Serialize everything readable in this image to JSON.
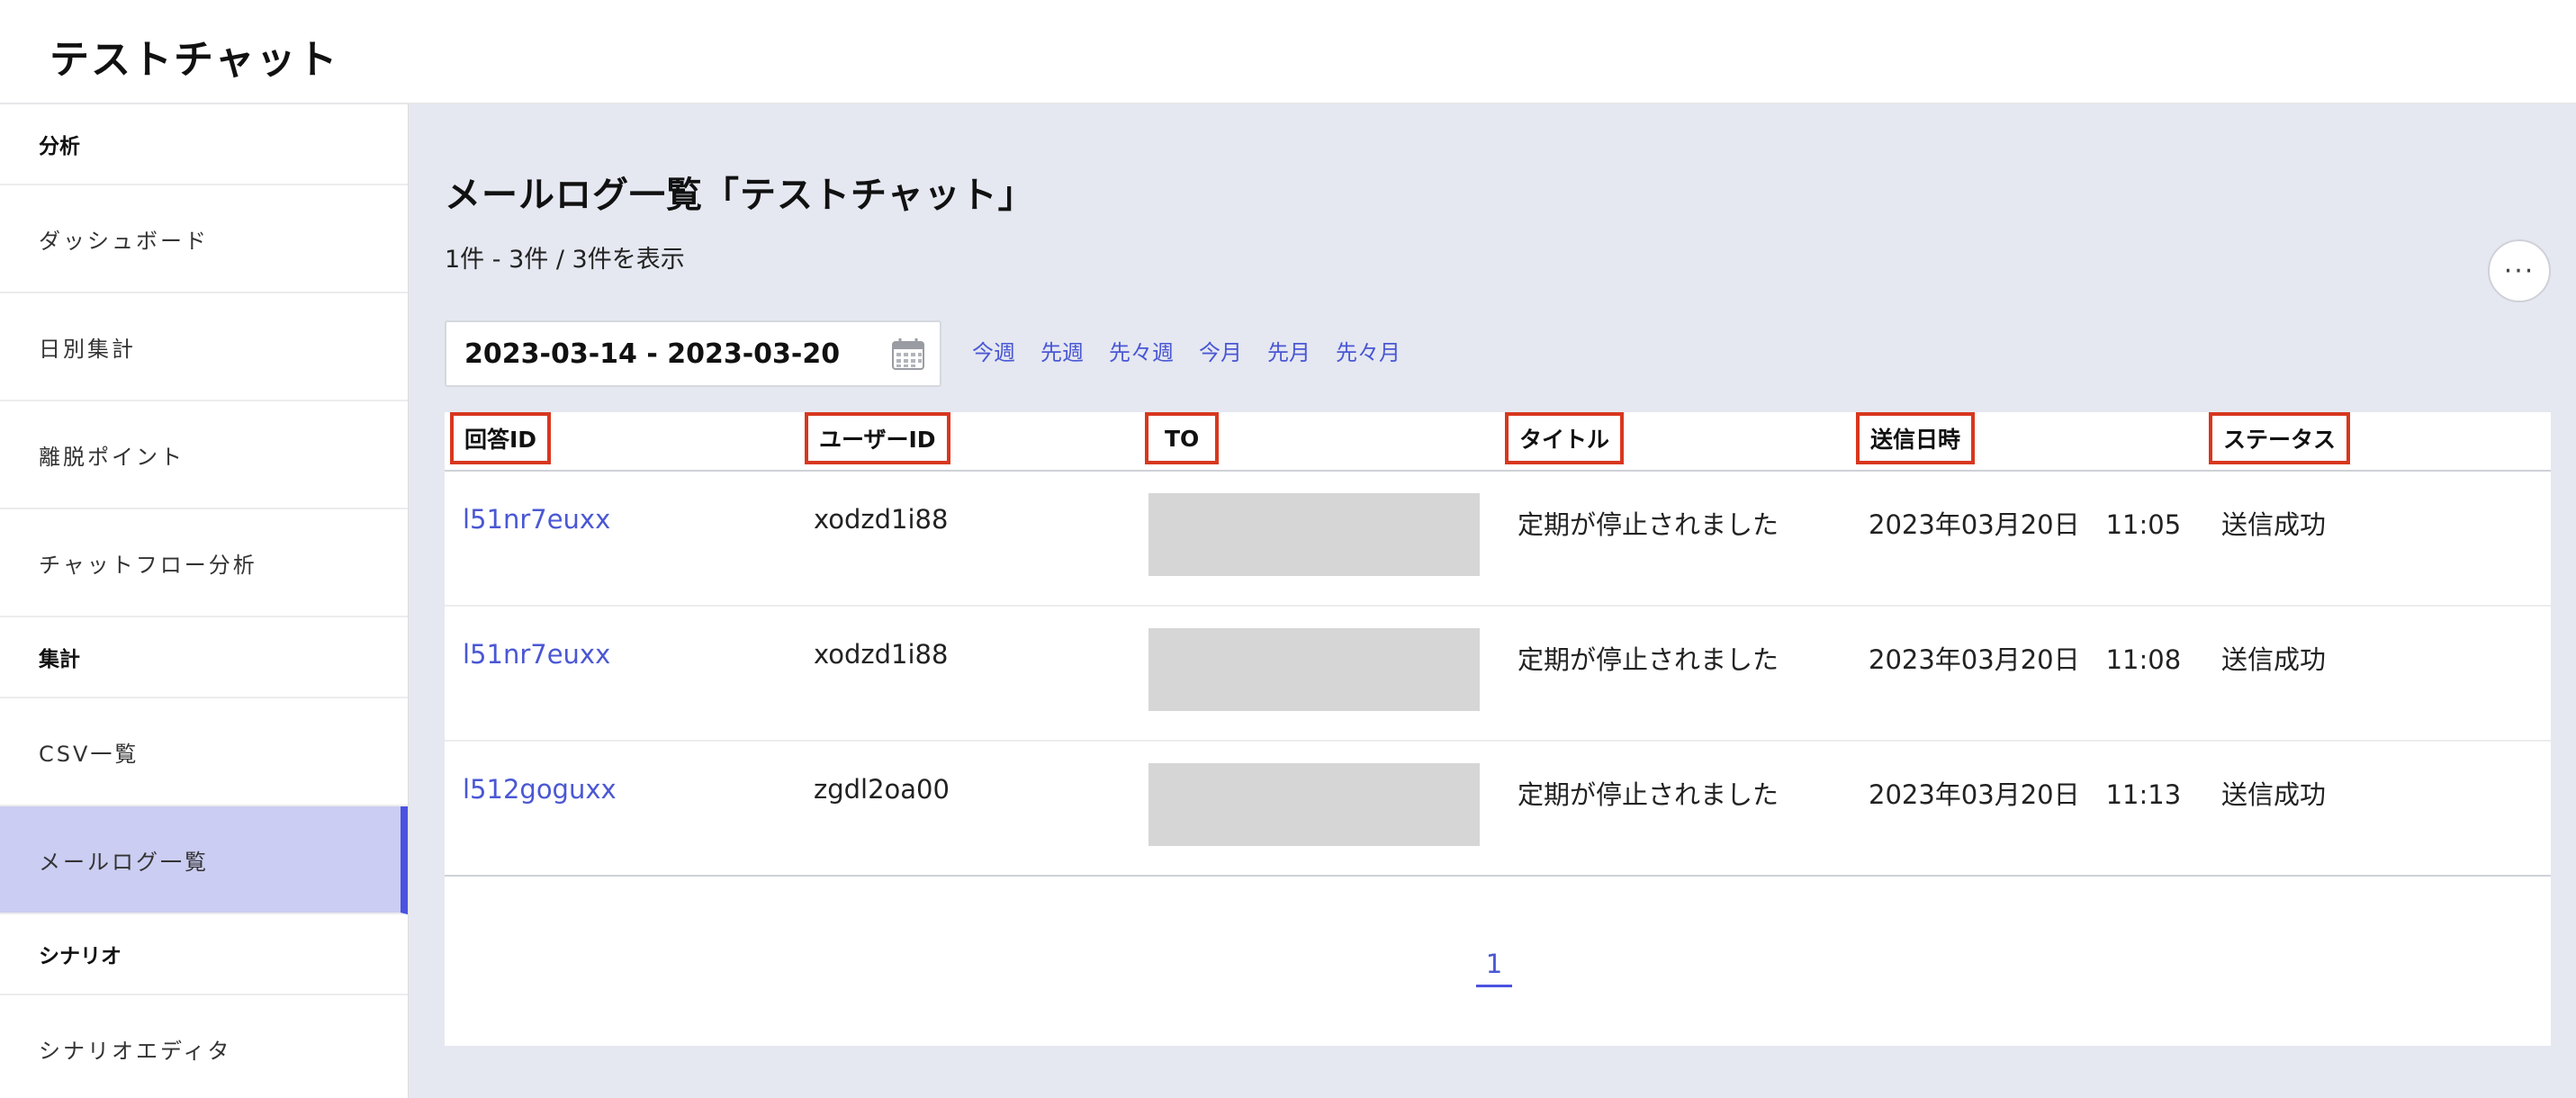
{
  "app": {
    "title": "テストチャット"
  },
  "sidebar": {
    "sections": [
      {
        "label": "分析",
        "items": [
          "ダッシュボード",
          "日別集計",
          "離脱ポイント",
          "チャットフロー分析"
        ]
      },
      {
        "label": "集計",
        "items": [
          "CSV一覧",
          "メールログ一覧"
        ]
      },
      {
        "label": "シナリオ",
        "items": [
          "シナリオエディタ"
        ]
      }
    ],
    "active": "メールログ一覧"
  },
  "main": {
    "title": "メールログ一覧「テストチャット」",
    "count": "1件 - 3件 / 3件を表示",
    "more_label": "···",
    "date_range": "2023-03-14 - 2023-03-20",
    "quick_ranges": [
      "今週",
      "先週",
      "先々週",
      "今月",
      "先月",
      "先々月"
    ]
  },
  "table": {
    "columns": [
      "回答ID",
      "ユーザーID",
      "TO",
      "タイトル",
      "送信日時",
      "ステータス"
    ],
    "rows": [
      {
        "answer_id": "l51nr7euxx",
        "user_id": "xodzd1i88",
        "to": "",
        "title": "定期が停止されました",
        "sent_at": "2023年03月20日　11:05",
        "status": "送信成功"
      },
      {
        "answer_id": "l51nr7euxx",
        "user_id": "xodzd1i88",
        "to": "",
        "title": "定期が停止されました",
        "sent_at": "2023年03月20日　11:08",
        "status": "送信成功"
      },
      {
        "answer_id": "l512goguxx",
        "user_id": "zgdl2oa00",
        "to": "",
        "title": "定期が停止されました",
        "sent_at": "2023年03月20日　11:13",
        "status": "送信成功"
      }
    ]
  },
  "pagination": {
    "current": "1"
  },
  "colors": {
    "accent": "#4a52e0",
    "link": "#4a57d4",
    "active_bg": "#cbcdf2",
    "header_outline": "#d8371f",
    "page_bg": "#e5e8f1"
  },
  "icons": {
    "date_picker": "calendar-icon",
    "more": "more-icon"
  }
}
